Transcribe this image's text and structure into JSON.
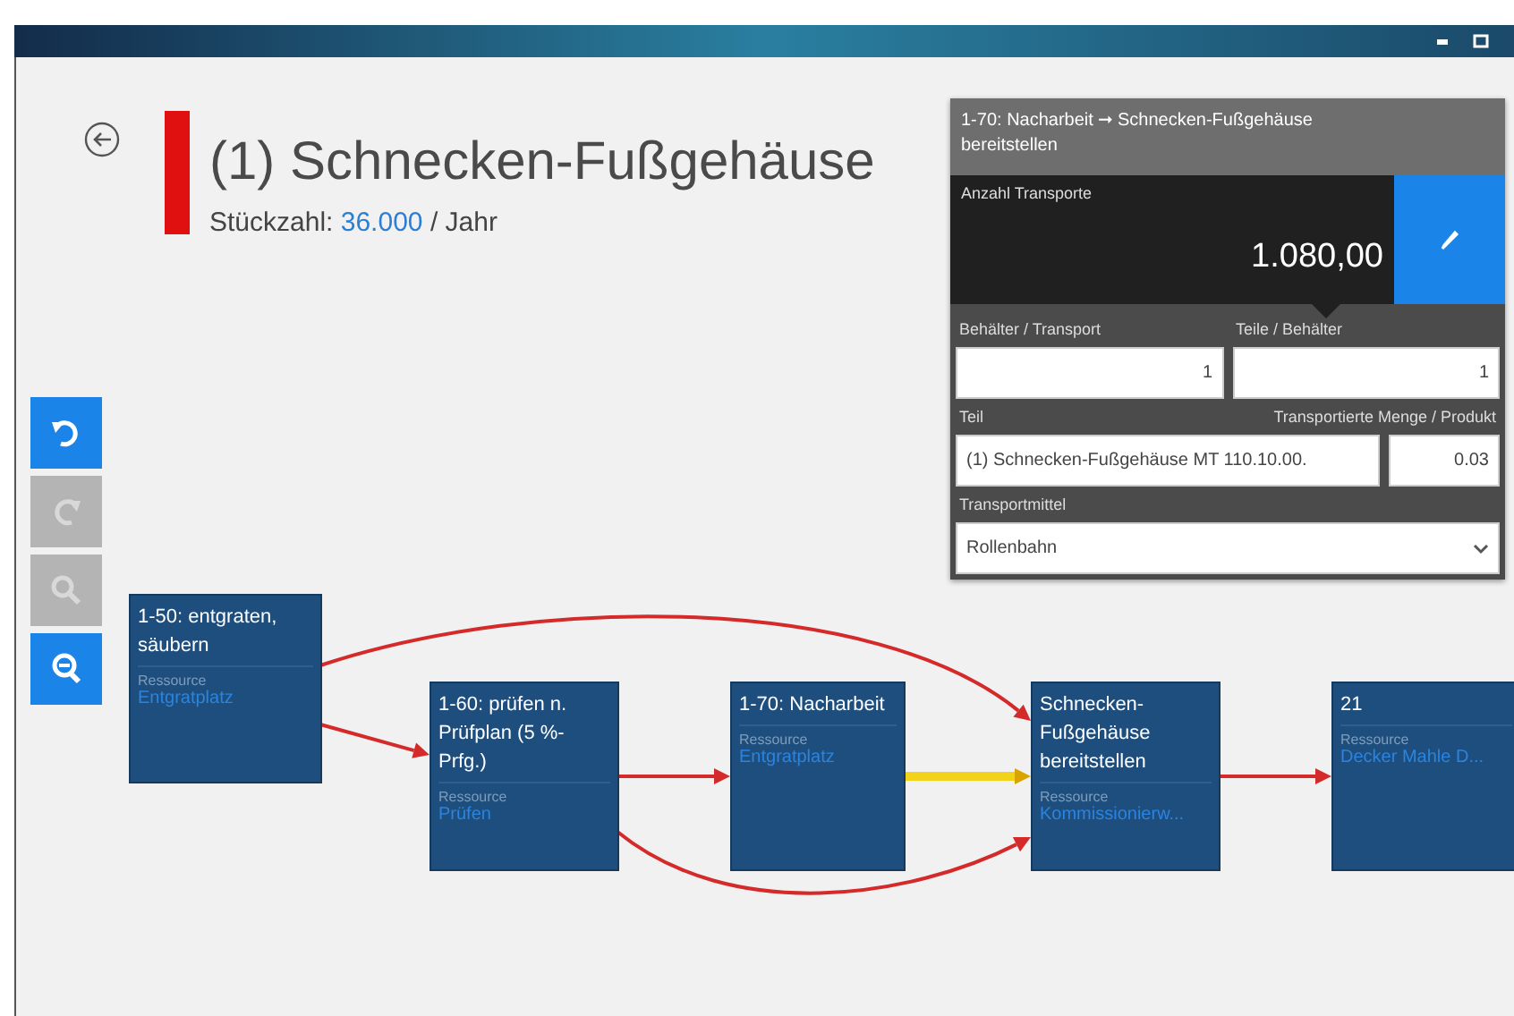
{
  "header": {
    "title": "(1) Schnecken-Fußgehäuse",
    "quantity_label": "Stückzahl:",
    "quantity": "36.000",
    "quantity_unit": "/ Jahr"
  },
  "toolbar": [
    {
      "kind": "undo",
      "disabled": false
    },
    {
      "kind": "redo",
      "disabled": true
    },
    {
      "kind": "zoom-in",
      "disabled": true
    },
    {
      "kind": "zoom-out",
      "disabled": false
    }
  ],
  "nodes": [
    {
      "title": "1-50: entgraten, säubern",
      "resource_label": "Ressource",
      "resource": "Entgratplatz"
    },
    {
      "title": "1-60: prüfen n. Prüfplan (5 %-Prfg.)",
      "resource_label": "Ressource",
      "resource": "Prüfen"
    },
    {
      "title": "1-70: Nacharbeit",
      "resource_label": "Ressource",
      "resource": "Entgratplatz"
    },
    {
      "title": "Schnecken-Fußgehäuse bereitstellen",
      "resource_label": "Ressource",
      "resource": "Kommissionierw..."
    },
    {
      "title": "21",
      "resource_label": "Ressource",
      "resource": "Decker Mahle D..."
    }
  ],
  "edges": [
    {
      "selected": false
    },
    {
      "selected": false
    },
    {
      "selected": false
    },
    {
      "selected": true
    },
    {
      "selected": false
    },
    {
      "selected": false
    }
  ],
  "panel": {
    "title": "1-70: Nacharbeit ➞ Schnecken-Fußgehäuse bereitstellen",
    "count_label": "Anzahl Transporte",
    "count": "1.080,00",
    "fields": [
      {
        "label": "Behälter / Transport",
        "value": "1"
      },
      {
        "label": "Teile / Behälter",
        "value": "1"
      }
    ],
    "part_label": "Teil",
    "amount_label": "Transportierte Menge / Produkt",
    "part": "(1) Schnecken-Fußgehäuse MT 110.10.00.",
    "amount": "0.03",
    "transport_label": "Transportmittel",
    "transport": "Rollenbahn"
  }
}
